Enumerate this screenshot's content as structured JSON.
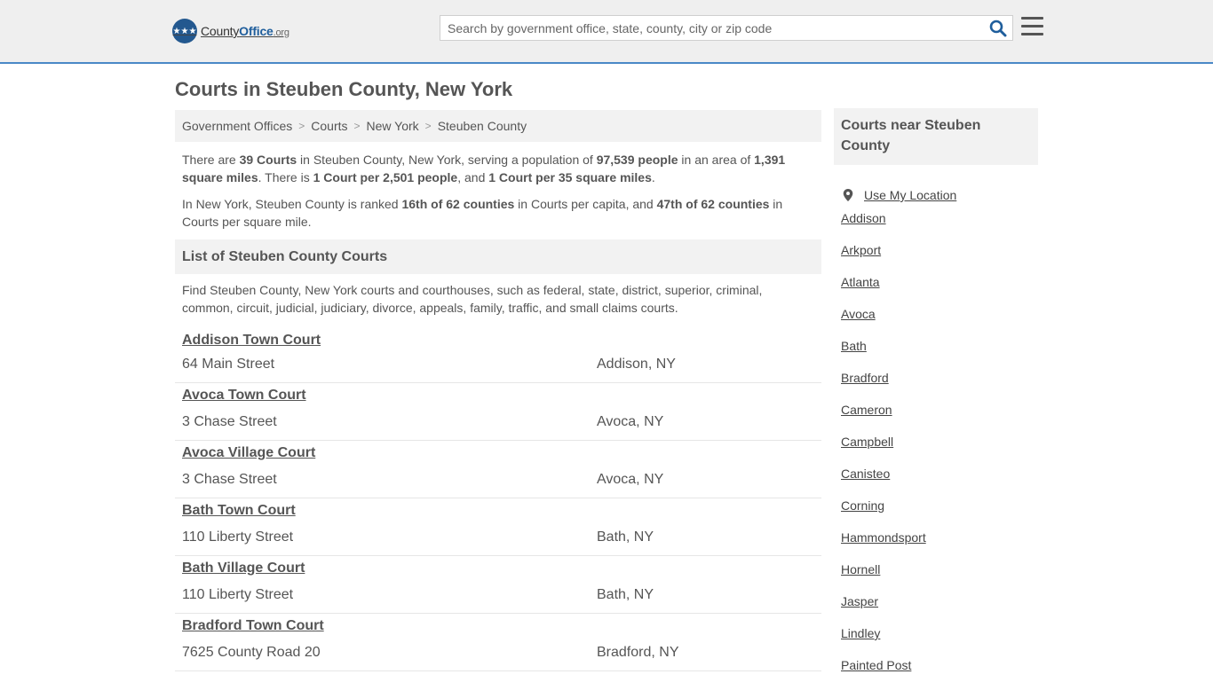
{
  "header": {
    "logo_word_plain": "County",
    "logo_word_strong": "Office",
    "logo_tld": ".org",
    "search_placeholder": "Search by government office, state, county, city or zip code"
  },
  "page_title": "Courts in Steuben County, New York",
  "breadcrumb": [
    "Government Offices",
    "Courts",
    "New York",
    "Steuben County"
  ],
  "intro": {
    "p1": {
      "t1": "There are ",
      "b1": "39 Courts",
      "t2": " in Steuben County, New York, serving a population of ",
      "b2": "97,539 people",
      "t3": " in an area of ",
      "b3": "1,391 square miles",
      "t4": ". There is ",
      "b4": "1 Court per 2,501 people",
      "t5": ", and ",
      "b5": "1 Court per 35 square miles",
      "t6": "."
    },
    "p2": {
      "t1": "In New York, Steuben County is ranked ",
      "b1": "16th of 62 counties",
      "t2": " in Courts per capita, and ",
      "b2": "47th of 62 counties",
      "t3": " in Courts per square mile."
    }
  },
  "list_section": {
    "heading": "List of Steuben County Courts",
    "description": "Find Steuben County, New York courts and courthouses, such as federal, state, district, superior, criminal, common, circuit, judicial, judiciary, divorce, appeals, family, traffic, and small claims courts.",
    "courts": [
      {
        "name": "Addison Town Court",
        "address": "64 Main Street",
        "city": "Addison, NY"
      },
      {
        "name": "Avoca Town Court",
        "address": "3 Chase Street",
        "city": "Avoca, NY"
      },
      {
        "name": "Avoca Village Court",
        "address": "3 Chase Street",
        "city": "Avoca, NY"
      },
      {
        "name": "Bath Town Court",
        "address": "110 Liberty Street",
        "city": "Bath, NY"
      },
      {
        "name": "Bath Village Court",
        "address": "110 Liberty Street",
        "city": "Bath, NY"
      },
      {
        "name": "Bradford Town Court",
        "address": "7625 County Road 20",
        "city": "Bradford, NY"
      }
    ]
  },
  "sidebar": {
    "heading": "Courts near Steuben County",
    "use_location": "Use My Location",
    "places": [
      "Addison",
      "Arkport",
      "Atlanta",
      "Avoca",
      "Bath",
      "Bradford",
      "Cameron",
      "Campbell",
      "Canisteo",
      "Corning",
      "Hammondsport",
      "Hornell",
      "Jasper",
      "Lindley",
      "Painted Post"
    ]
  }
}
